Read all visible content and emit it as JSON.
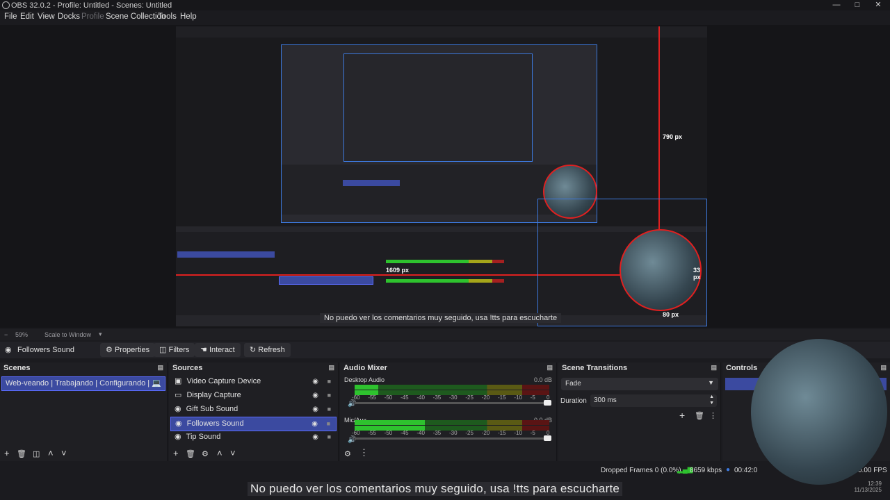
{
  "window": {
    "title": "OBS 32.0.2 - Profile: Untitled - Scenes: Untitled"
  },
  "menu": [
    "File",
    "Edit",
    "View",
    "Docks",
    "Profile",
    "Scene Collection",
    "Tools",
    "Help"
  ],
  "preview": {
    "measure_vertical": "790 px",
    "measure_horizontal": "1609 px",
    "measure_right": "33 px",
    "measure_bottom": "80 px",
    "subtitle": "No puedo ver los comentarios muy seguido, usa !tts para escucharte"
  },
  "zoom": {
    "value": "59%",
    "mode": "Scale to Window"
  },
  "source_toolbar": {
    "current_source": "Followers Sound",
    "buttons": [
      "Properties",
      "Filters",
      "Interact",
      "Refresh"
    ]
  },
  "docks": {
    "scenes": {
      "title": "Scenes",
      "items": [
        "Web-veando | Trabajando | Configurando | 💻"
      ]
    },
    "sources": {
      "title": "Sources",
      "items": [
        "Video Capture Device",
        "Display Capture",
        "Gift Sub Sound",
        "Followers Sound",
        "Tip Sound"
      ],
      "selected": "Followers Sound"
    },
    "audio_mixer": {
      "title": "Audio Mixer",
      "channels": [
        {
          "name": "Desktop Audio",
          "db": "0.0 dB",
          "level": 0.12
        },
        {
          "name": "Mic/Aux",
          "db": "0.0 dB",
          "level": 0.36
        }
      ],
      "scale": [
        "-60",
        "-55",
        "-50",
        "-45",
        "-40",
        "-35",
        "-30",
        "-25",
        "-20",
        "-15",
        "-10",
        "-5",
        "0"
      ]
    },
    "transitions": {
      "title": "Scene Transitions",
      "type": "Fade",
      "duration_label": "Duration",
      "duration": "300 ms"
    },
    "controls": {
      "title": "Controls"
    }
  },
  "status": {
    "dropped": "Dropped Frames 0 (0.0%)",
    "bitrate": "8659 kbps",
    "time": "00:42:0",
    "fps": "0.00 FPS"
  },
  "subtitle_overlay": "No puedo ver los comentarios muy seguido, usa !tts para escucharte",
  "clock": {
    "time": "12:39",
    "date": "11/13/2025"
  },
  "colors": {
    "accent": "#3b4aa0",
    "selection_border": "#5b6cff",
    "guide_red": "#e02020",
    "meter_green": "#2ec22e",
    "meter_yellow": "#a5a51a",
    "meter_red": "#a52020"
  }
}
